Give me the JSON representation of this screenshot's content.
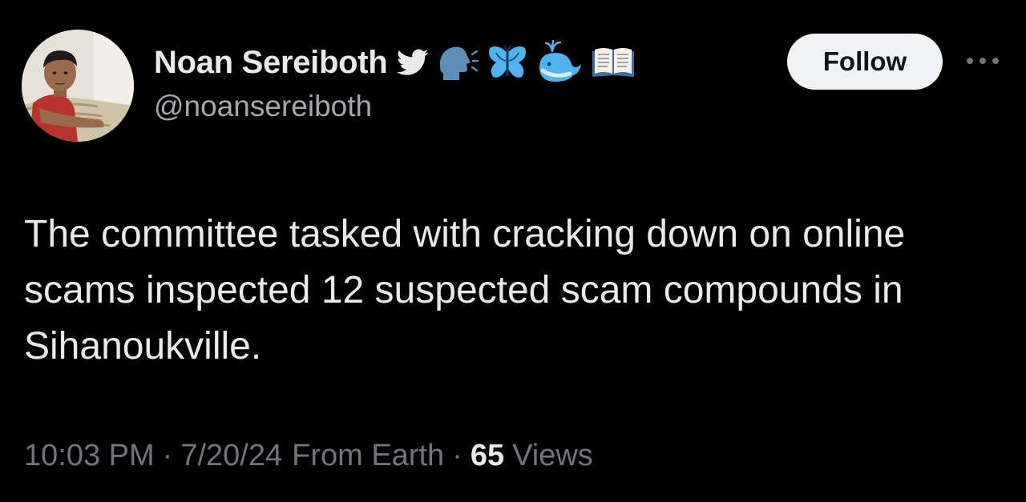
{
  "user": {
    "display_name": "Noan Sereiboth",
    "handle": "@noansereiboth",
    "name_icons": [
      "twitter-bird-icon",
      "speaking-head-icon",
      "butterfly-icon",
      "spouting-whale-icon",
      "open-book-icon"
    ]
  },
  "actions": {
    "follow_label": "Follow",
    "more_icon": "more-horizontal-icon"
  },
  "tweet": {
    "text": "The committee tasked with cracking down on online scams inspected 12 suspected scam compounds in Sihanoukville."
  },
  "meta": {
    "time": "10:03 PM",
    "separator": "·",
    "date": "7/20/24",
    "source": "From Earth",
    "views_count": "65",
    "views_label": "Views"
  },
  "colors": {
    "background": "#000000",
    "primary_text": "#e7e9ea",
    "secondary_text": "#a3a8ad",
    "meta_text": "#6f767b",
    "follow_bg": "#eff3f4",
    "emoji_blue": "#4fb3ef"
  }
}
